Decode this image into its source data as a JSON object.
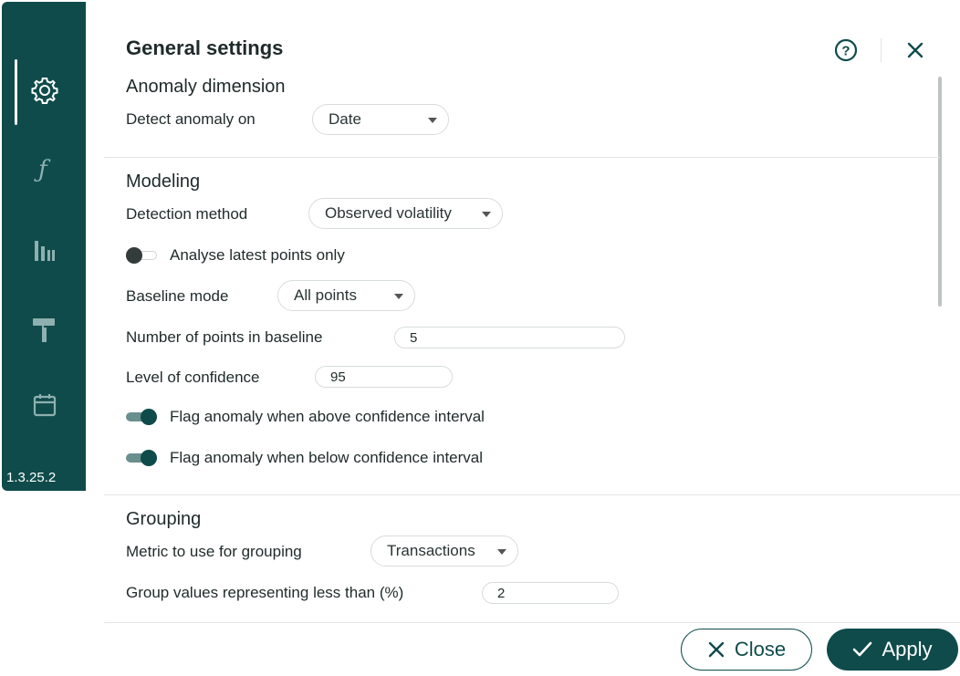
{
  "sidebar": {
    "version": "1.3.25.2",
    "items": [
      {
        "icon": "gear-icon",
        "active": true
      },
      {
        "icon": "function-icon",
        "active": false
      },
      {
        "icon": "bar-chart-icon",
        "active": false
      },
      {
        "icon": "paint-roller-icon",
        "active": false
      },
      {
        "icon": "calendar-icon",
        "active": false
      }
    ]
  },
  "header": {
    "title": "General settings",
    "help_icon": "help-circle-icon",
    "close_icon": "close-icon"
  },
  "anomaly_dimension": {
    "title": "Anomaly dimension",
    "detect_label": "Detect anomaly on",
    "detect_value": "Date"
  },
  "modeling": {
    "title": "Modeling",
    "method_label": "Detection method",
    "method_value": "Observed volatility",
    "latest_points_label": "Analyse latest points only",
    "latest_points_on": false,
    "baseline_mode_label": "Baseline mode",
    "baseline_mode_value": "All points",
    "points_in_baseline_label": "Number of points in baseline",
    "points_in_baseline_value": "5",
    "confidence_label": "Level of confidence",
    "confidence_value": "95",
    "flag_above_label": "Flag anomaly when above confidence interval",
    "flag_above_on": true,
    "flag_below_label": "Flag anomaly when below confidence interval",
    "flag_below_on": true
  },
  "grouping": {
    "title": "Grouping",
    "metric_label": "Metric to use for grouping",
    "metric_value": "Transactions",
    "threshold_label": "Group values representing less than (%)",
    "threshold_value": "2"
  },
  "footer": {
    "close_label": "Close",
    "apply_label": "Apply"
  },
  "colors": {
    "brand": "#0f4b4b",
    "text": "#1f2a2a"
  }
}
